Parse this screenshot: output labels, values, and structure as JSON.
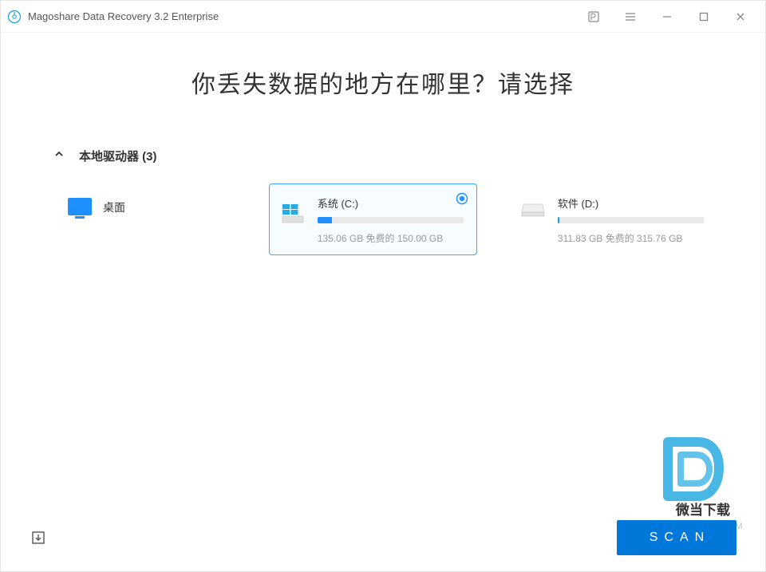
{
  "titlebar": {
    "app_title": "Magoshare Data Recovery 3.2 Enterprise"
  },
  "headline": "你丢失数据的地方在哪里？请选择",
  "group": {
    "title": "本地驱动器 (3)"
  },
  "desktop": {
    "label": "桌面"
  },
  "drives": [
    {
      "name": "系统 (C:)",
      "free_text": "135.06 GB 免费的 150.00 GB",
      "fill_percent": 10,
      "selected": true,
      "os": true
    },
    {
      "name": "软件 (D:)",
      "free_text": "311.83 GB 免费的 315.76 GB",
      "fill_percent": 1.3,
      "selected": false,
      "os": false
    }
  ],
  "scan": {
    "label": "SCAN"
  },
  "watermark": {
    "text": "微当下载",
    "url": "WWW.WEIDOWN.COM"
  }
}
